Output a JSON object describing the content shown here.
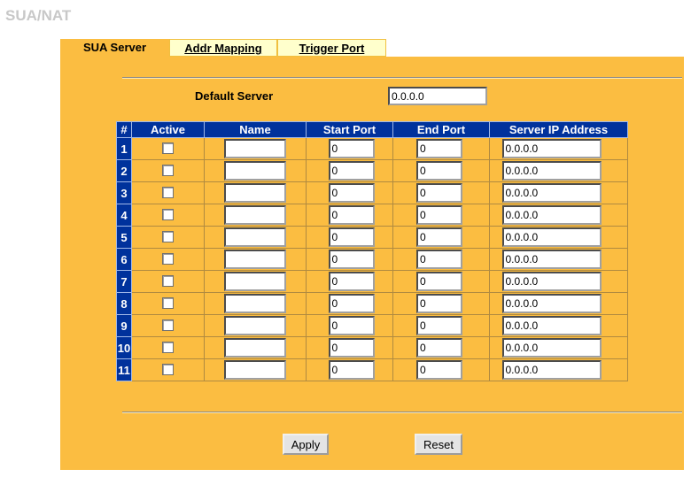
{
  "page": {
    "title": "SUA/NAT"
  },
  "tabs": [
    {
      "label": "SUA Server",
      "active": true
    },
    {
      "label": "Addr Mapping",
      "active": false
    },
    {
      "label": "Trigger Port",
      "active": false
    }
  ],
  "default_server": {
    "label": "Default Server",
    "value": "0.0.0.0"
  },
  "table": {
    "headers": [
      "#",
      "Active",
      "Name",
      "Start Port",
      "End Port",
      "Server IP Address"
    ],
    "rows": [
      {
        "num": "1",
        "active": false,
        "name": "",
        "start_port": "0",
        "end_port": "0",
        "server_ip": "0.0.0.0"
      },
      {
        "num": "2",
        "active": false,
        "name": "",
        "start_port": "0",
        "end_port": "0",
        "server_ip": "0.0.0.0"
      },
      {
        "num": "3",
        "active": false,
        "name": "",
        "start_port": "0",
        "end_port": "0",
        "server_ip": "0.0.0.0"
      },
      {
        "num": "4",
        "active": false,
        "name": "",
        "start_port": "0",
        "end_port": "0",
        "server_ip": "0.0.0.0"
      },
      {
        "num": "5",
        "active": false,
        "name": "",
        "start_port": "0",
        "end_port": "0",
        "server_ip": "0.0.0.0"
      },
      {
        "num": "6",
        "active": false,
        "name": "",
        "start_port": "0",
        "end_port": "0",
        "server_ip": "0.0.0.0"
      },
      {
        "num": "7",
        "active": false,
        "name": "",
        "start_port": "0",
        "end_port": "0",
        "server_ip": "0.0.0.0"
      },
      {
        "num": "8",
        "active": false,
        "name": "",
        "start_port": "0",
        "end_port": "0",
        "server_ip": "0.0.0.0"
      },
      {
        "num": "9",
        "active": false,
        "name": "",
        "start_port": "0",
        "end_port": "0",
        "server_ip": "0.0.0.0"
      },
      {
        "num": "10",
        "active": false,
        "name": "",
        "start_port": "0",
        "end_port": "0",
        "server_ip": "0.0.0.0"
      },
      {
        "num": "11",
        "active": false,
        "name": "",
        "start_port": "0",
        "end_port": "0",
        "server_ip": "0.0.0.0"
      }
    ]
  },
  "buttons": {
    "apply": "Apply",
    "reset": "Reset"
  },
  "colors": {
    "panel": "#fbbd41",
    "header": "#00329c",
    "title": "#c8c8c8",
    "tab_inactive": "#ffffcc"
  }
}
